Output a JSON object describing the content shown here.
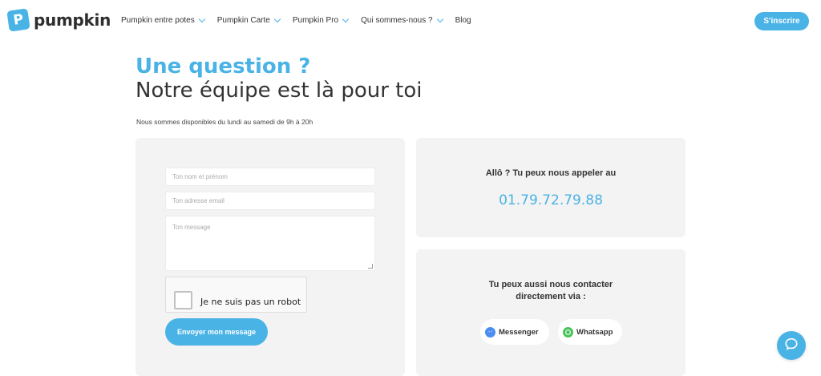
{
  "brand": {
    "name": "pumpkin",
    "logo_letter": "P",
    "accent_color": "#4ab3e6"
  },
  "nav": {
    "items": [
      {
        "label": "Pumpkin entre potes",
        "has_dropdown": true
      },
      {
        "label": "Pumpkin Carte",
        "has_dropdown": true
      },
      {
        "label": "Pumpkin Pro",
        "has_dropdown": true
      },
      {
        "label": "Qui sommes-nous ?",
        "has_dropdown": true
      },
      {
        "label": "Blog",
        "has_dropdown": false
      }
    ],
    "signup_label": "S'inscrire"
  },
  "hero": {
    "title": "Une question ?",
    "subtitle": "Notre équipe est là pour toi",
    "availability": "Nous sommes disponibles du lundi au samedi de 9h à 20h"
  },
  "form": {
    "name_placeholder": "Ton nom et prénom",
    "email_placeholder": "Ton adresse email",
    "message_placeholder": "Ton message",
    "captcha_label": "Je ne suis pas un robot",
    "submit_label": "Envoyer mon message"
  },
  "phone": {
    "label": "Allô ? Tu peux nous appeler au",
    "number": "01.79.72.79.88"
  },
  "contact": {
    "line1": "Tu peux aussi nous contacter",
    "line2": "directement via :",
    "messenger_label": "Messenger",
    "whatsapp_label": "Whatsapp"
  },
  "icons": {
    "chevron": "chevron-down-icon",
    "messenger": "messenger-icon",
    "whatsapp": "whatsapp-icon",
    "chat": "chat-bubble-icon"
  }
}
